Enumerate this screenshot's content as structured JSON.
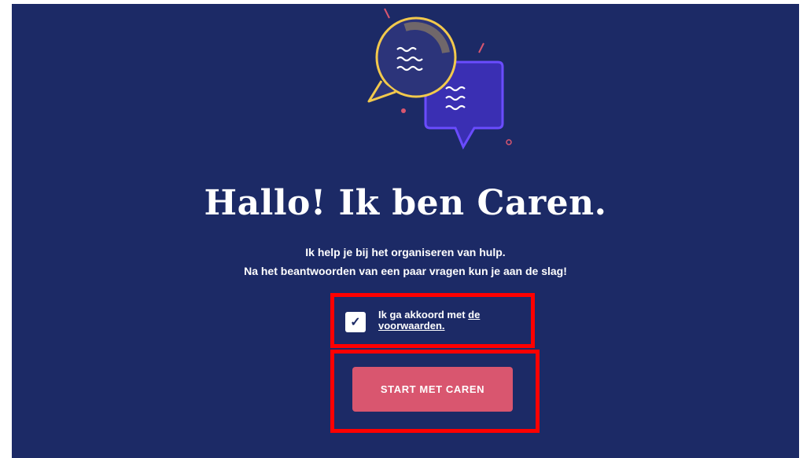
{
  "hero": {
    "title": "Hallo! Ik ben Caren.",
    "subtitle_line1": "Ik help je bij het organiseren van hulp.",
    "subtitle_line2": "Na het beantwoorden van een paar vragen kun je aan de slag!"
  },
  "consent": {
    "checked": true,
    "checkmark": "✓",
    "text": "Ik ga akkoord met",
    "link_text": "de voorwaarden."
  },
  "cta": {
    "label": "START MET CAREN"
  },
  "colors": {
    "background": "#1c2a66",
    "accent_yellow": "#f2c94c",
    "accent_purple": "#5b3df5",
    "button": "#d9566f",
    "highlight_border": "#ff0000"
  },
  "icons": [
    "chat-bubbles-illustration-icon",
    "checkmark-icon"
  ]
}
